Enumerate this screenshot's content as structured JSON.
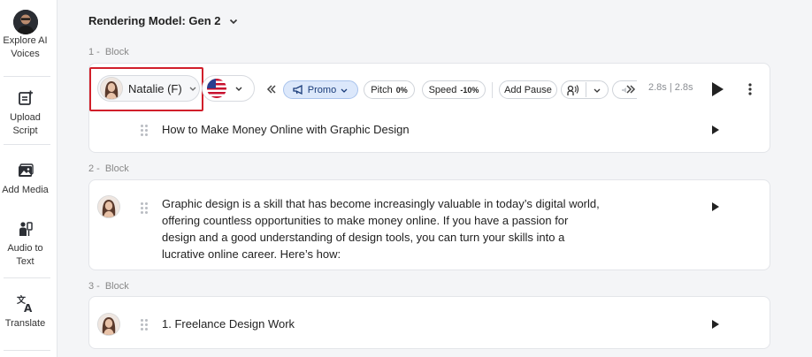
{
  "sidebar": {
    "items": [
      {
        "label": "Explore AI Voices",
        "icon": "user-avatar-icon"
      },
      {
        "label": "Upload Script",
        "icon": "upload-script-icon"
      },
      {
        "label": "Add Media",
        "icon": "media-icon"
      },
      {
        "label": "Audio to Text",
        "icon": "audio-to-text-icon"
      },
      {
        "label": "Translate",
        "icon": "translate-icon"
      }
    ]
  },
  "header": {
    "rendering_model": "Rendering Model: Gen 2"
  },
  "blocks": [
    {
      "number": "1 -",
      "label": "Block",
      "text": "How to Make Money Online with Graphic Design"
    },
    {
      "number": "2 -",
      "label": "Block",
      "text": "Graphic design is a skill that has become increasingly valuable in today’s digital world, offering countless opportunities to make money online. If you have a passion for design and a good understanding of design tools, you can turn your skills into a lucrative online career. Here’s how:"
    },
    {
      "number": "3 -",
      "label": "Block",
      "text": "1. Freelance Design Work"
    }
  ],
  "toolbar": {
    "voice_name": "Natalie (F)",
    "style_label": "Promo",
    "pitch_label": "Pitch",
    "pitch_value": "0%",
    "speed_label": "Speed",
    "speed_value": "-10%",
    "add_pause_label": "Add Pause",
    "timing": "2.8s | 2.8s"
  },
  "colors": {
    "highlight": "#d11f2a",
    "promo_bg": "#dce8fb",
    "accent": "#1a3c7a"
  }
}
